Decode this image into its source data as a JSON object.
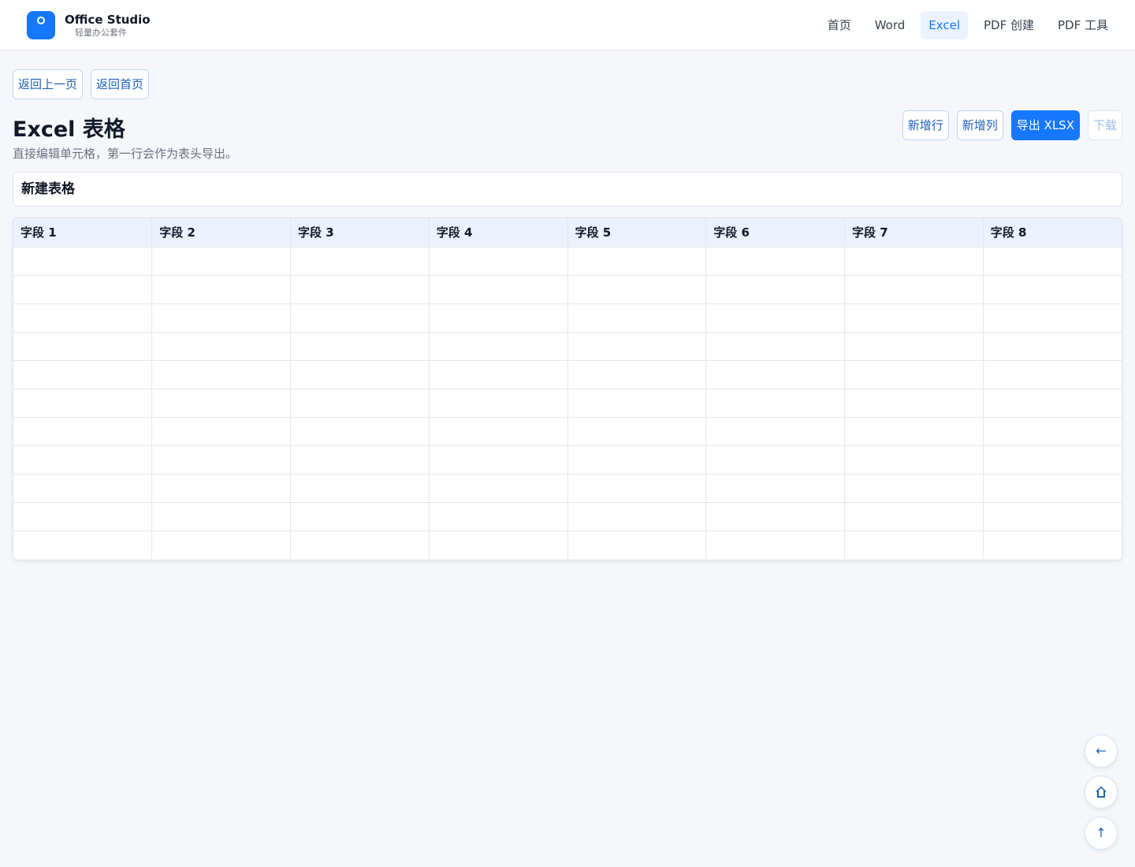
{
  "brand": {
    "name": "Office Studio",
    "subtitle": "轻量办公套件",
    "accent": "#1677ff"
  },
  "nav": {
    "items": [
      {
        "label": "首页",
        "active": false
      },
      {
        "label": "Word",
        "active": false
      },
      {
        "label": "Excel",
        "active": true
      },
      {
        "label": "PDF 创建",
        "active": false
      },
      {
        "label": "PDF 工具",
        "active": false
      }
    ]
  },
  "back": {
    "prev_label": "返回上一页",
    "home_label": "返回首页"
  },
  "page": {
    "title": "Excel 表格",
    "subtitle": "直接编辑单元格，第一行会作为表头导出。"
  },
  "actions": {
    "add_row": "新增行",
    "add_col": "新增列",
    "export": "导出 XLSX",
    "download": "下载"
  },
  "sheet": {
    "name": "新建表格",
    "headers": [
      "字段 1",
      "字段 2",
      "字段 3",
      "字段 4",
      "字段 5",
      "字段 6",
      "字段 7",
      "字段 8"
    ],
    "rows": [
      [
        "",
        "",
        "",
        "",
        "",
        "",
        "",
        ""
      ],
      [
        "",
        "",
        "",
        "",
        "",
        "",
        "",
        ""
      ],
      [
        "",
        "",
        "",
        "",
        "",
        "",
        "",
        ""
      ],
      [
        "",
        "",
        "",
        "",
        "",
        "",
        "",
        ""
      ],
      [
        "",
        "",
        "",
        "",
        "",
        "",
        "",
        ""
      ],
      [
        "",
        "",
        "",
        "",
        "",
        "",
        "",
        ""
      ],
      [
        "",
        "",
        "",
        "",
        "",
        "",
        "",
        ""
      ],
      [
        "",
        "",
        "",
        "",
        "",
        "",
        "",
        ""
      ],
      [
        "",
        "",
        "",
        "",
        "",
        "",
        "",
        ""
      ],
      [
        "",
        "",
        "",
        "",
        "",
        "",
        "",
        ""
      ],
      [
        "",
        "",
        "",
        "",
        "",
        "",
        "",
        ""
      ]
    ]
  },
  "fab": {
    "back_glyph": "←",
    "home_icon": "home-icon",
    "top_glyph": "↑"
  }
}
